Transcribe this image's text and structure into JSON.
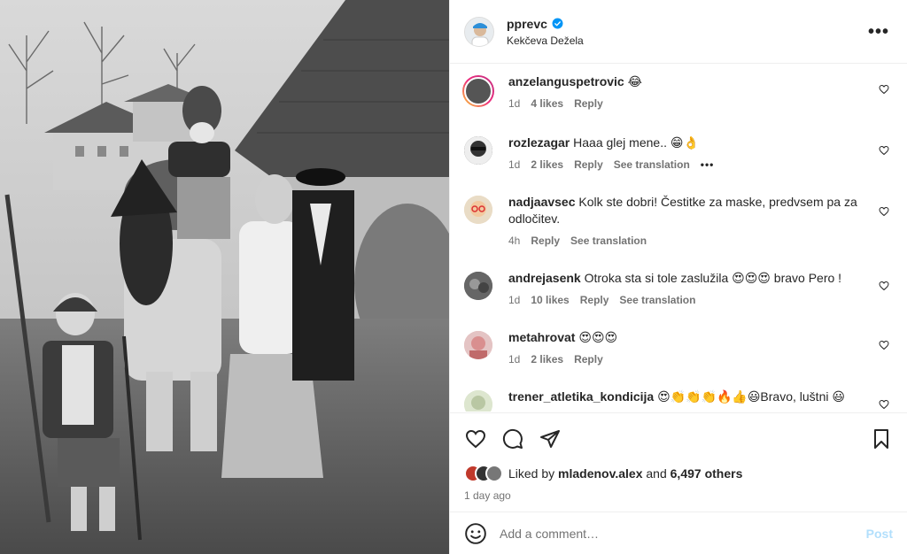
{
  "post": {
    "author": "pprevc",
    "location": "Kekčeva Dežela"
  },
  "comments": [
    {
      "user": "anzelanguspetrovic",
      "text": "😂",
      "time": "1d",
      "likes": "4 likes",
      "reply": "Reply",
      "translate": ""
    },
    {
      "user": "rozlezagar",
      "text": "Haaa glej mene.. 😁👌",
      "time": "1d",
      "likes": "2 likes",
      "reply": "Reply",
      "translate": "See translation",
      "more": "•••"
    },
    {
      "user": "nadjaavsec",
      "text": "Kolk ste dobri! Čestitke za maske, predvsem pa za odločitev.",
      "time": "4h",
      "likes": "",
      "reply": "Reply",
      "translate": "See translation"
    },
    {
      "user": "andrejasenk",
      "text": "Otroka sta si tole zaslužila 😍😍😍 bravo Pero !",
      "time": "1d",
      "likes": "10 likes",
      "reply": "Reply",
      "translate": "See translation"
    },
    {
      "user": "metahrovat",
      "text": "😍😍😍",
      "time": "1d",
      "likes": "2 likes",
      "reply": "Reply",
      "translate": ""
    },
    {
      "user": "trener_atletika_kondicija",
      "text": "😍👏👏👏🔥👍😃Bravo, luštni 😃",
      "time": "",
      "likes": "",
      "reply": "",
      "translate": ""
    }
  ],
  "actions": {
    "liked_by_prefix": "Liked by",
    "liked_by_user": "mladenov.alex",
    "and": "and",
    "others": "6,497 others",
    "time_ago": "1 day ago"
  },
  "composer": {
    "placeholder": "Add a comment…",
    "post_label": "Post"
  },
  "colors": {
    "verified": "#0095f6",
    "story_ring_start": "#f9ce34",
    "story_ring_end": "#c13584",
    "post_disabled": "#b2dffc",
    "secondary_text": "#737373"
  },
  "icons": [
    "verified-badge-icon",
    "more-options-icon",
    "heart-icon",
    "comment-icon",
    "share-icon",
    "bookmark-icon",
    "emoji-icon"
  ]
}
